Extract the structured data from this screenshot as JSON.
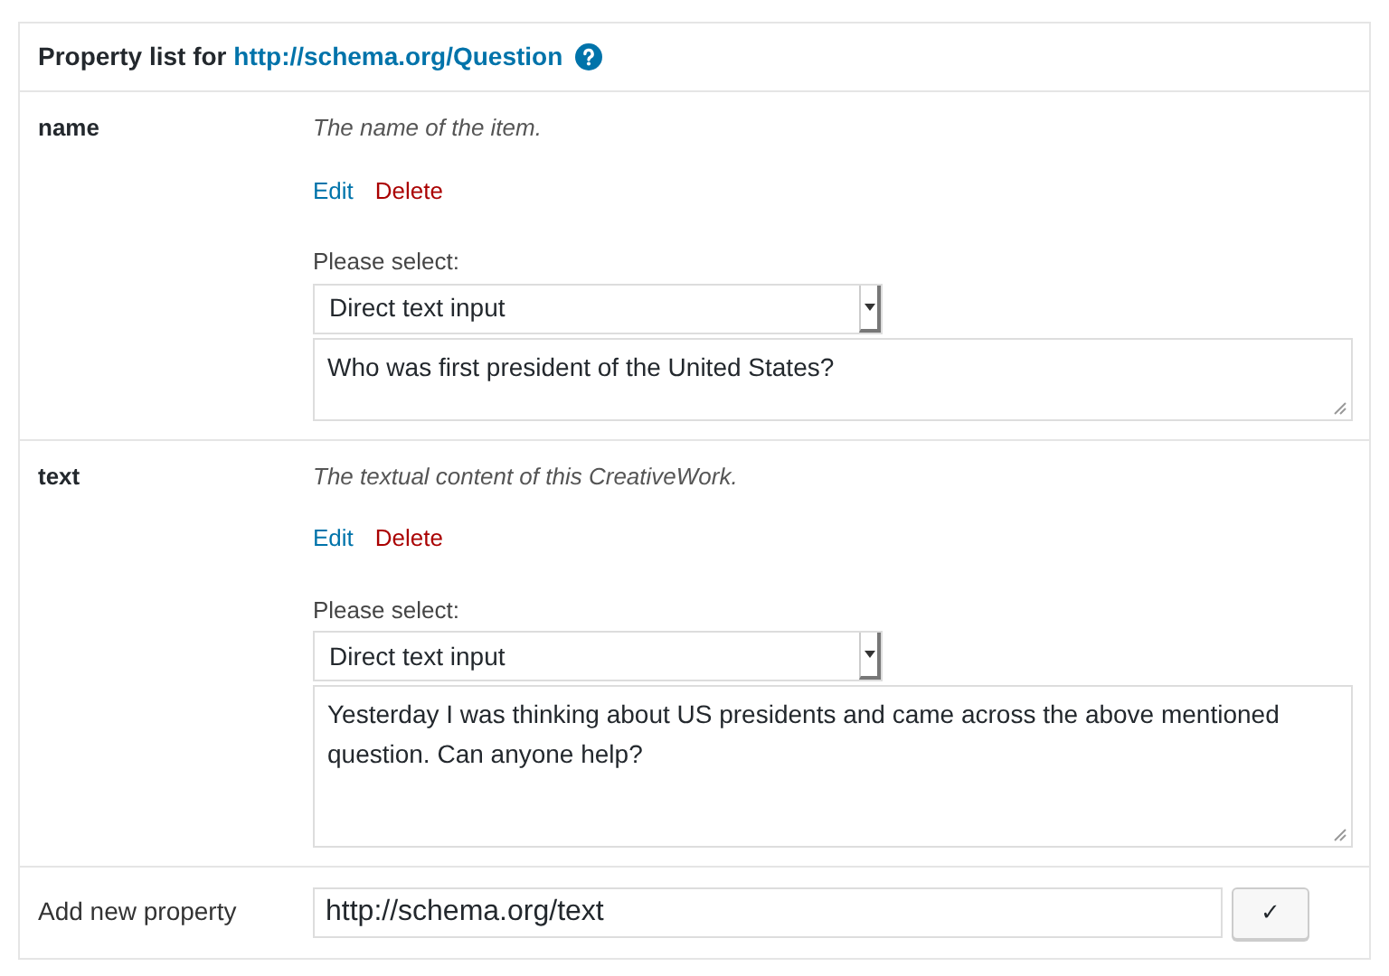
{
  "header": {
    "title": "Property list for ",
    "link": "http://schema.org/Question"
  },
  "properties": [
    {
      "name": "name",
      "description": "The name of the item.",
      "edit": "Edit",
      "delete": "Delete",
      "select_label": "Please select:",
      "select_value": "Direct text input",
      "value": "Who was first president of the United States?"
    },
    {
      "name": "text",
      "description": "The textual content of this CreativeWork.",
      "edit": "Edit",
      "delete": "Delete",
      "select_label": "Please select:",
      "select_value": "Direct text input",
      "value": "Yesterday I was thinking about US presidents and came across the above mentioned question. Can anyone help?"
    }
  ],
  "add_property": {
    "label": "Add new property",
    "value": "http://schema.org/text",
    "button": "✓"
  }
}
